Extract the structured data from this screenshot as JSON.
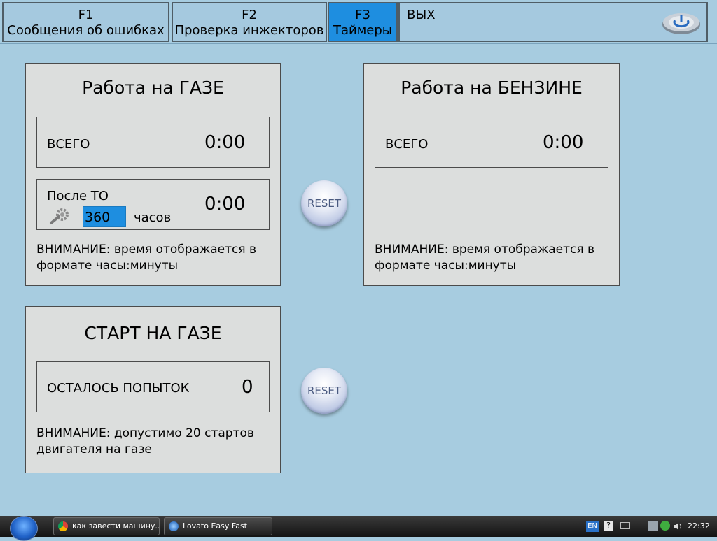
{
  "tabs": [
    {
      "key": "F1",
      "label": "Сообщения об ошибках"
    },
    {
      "key": "F2",
      "label": "Проверка инжекторов"
    },
    {
      "key": "F3",
      "label": "Таймеры"
    }
  ],
  "exit_label": "ВЫХ",
  "gas_panel": {
    "title": "Работа на ГАЗЕ",
    "total_label": "ВСЕГО",
    "total_value": "0:00",
    "after_service_label": "После ТО",
    "service_hours_value": "360",
    "hours_unit": "часов",
    "after_service_value": "0:00",
    "note_line1": "ВНИМАНИЕ: время отображается в",
    "note_line2": "формате часы:минуты"
  },
  "petrol_panel": {
    "title": "Работа на  БЕНЗИНЕ",
    "total_label": "ВСЕГО",
    "total_value": "0:00",
    "note_line1": "ВНИМАНИЕ: время отображается в",
    "note_line2": "формате часы:минуты"
  },
  "gas_start_panel": {
    "title": "СТАРТ НА ГАЗЕ",
    "attempts_label": "ОСТАЛОСЬ ПОПЫТОК",
    "attempts_value": "0",
    "note_line1": "ВНИМАНИЕ: допустимо 20 стартов",
    "note_line2": "двигателя на газе"
  },
  "reset_label": "RESET",
  "taskbar": {
    "items": [
      {
        "label": "как завести машину..."
      },
      {
        "label": "Lovato Easy Fast"
      }
    ],
    "lang": "EN",
    "help": "?",
    "clock": "22:32"
  },
  "icons": {
    "power": "power-icon",
    "service": "wrench-gear-icon",
    "start": "windows-start-icon",
    "chrome": "chrome-icon",
    "lovato": "lovato-app-icon"
  }
}
